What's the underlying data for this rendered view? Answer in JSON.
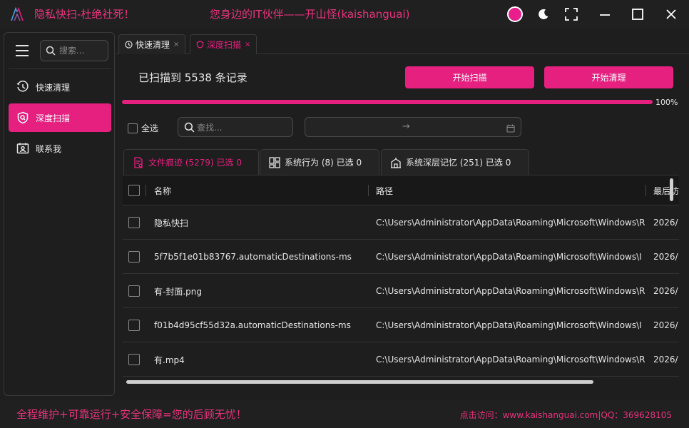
{
  "app": {
    "title": "隐私快扫-杜绝社死！",
    "slogan": "您身边的IT伙伴——开山怪(kaishanguai)"
  },
  "window_controls": {
    "theme_dot_color": "#e91e8c",
    "icons": [
      "theme-dot-icon",
      "moon-icon",
      "fullscreen-icon",
      "minimize-icon",
      "maximize-icon",
      "close-icon"
    ]
  },
  "sidebar": {
    "search_placeholder": "搜索...",
    "items": [
      {
        "label": "快速清理",
        "icon": "clock-icon",
        "active": false
      },
      {
        "label": "深度扫描",
        "icon": "shield-search-icon",
        "active": true
      },
      {
        "label": "联系我",
        "icon": "contact-card-icon",
        "active": false
      }
    ]
  },
  "doc_tabs": [
    {
      "label": "快速清理",
      "icon": "clock-icon",
      "close": "×",
      "active": false
    },
    {
      "label": "深度扫描",
      "icon": "shield-icon",
      "close": "×",
      "active": true
    }
  ],
  "scan": {
    "status": "已扫描到 5538 条记录",
    "start_scan_label": "开始扫描",
    "start_clean_label": "开始清理",
    "progress_percent": 100,
    "progress_text": "100%"
  },
  "filters": {
    "select_all_label": "全选",
    "search_placeholder": "查找...",
    "date_arrow": "→"
  },
  "category_tabs": [
    {
      "label": "文件痕迹 (5279) 已选 0",
      "icon": "file-trace-icon",
      "active": true
    },
    {
      "label": "系统行为 (8) 已选 0",
      "icon": "windows-grid-icon",
      "active": false
    },
    {
      "label": "系统深层记忆 (251) 已选 0",
      "icon": "building-icon",
      "active": false
    }
  ],
  "table": {
    "columns": [
      "名称",
      "路径",
      "最后访"
    ],
    "rows": [
      {
        "name": "隐私快扫",
        "path": "C:\\Users\\Administrator\\AppData\\Roaming\\Microsoft\\Windows\\R",
        "time": "2026/"
      },
      {
        "name": "5f7b5f1e01b83767.automaticDestinations-ms",
        "path": "C:\\Users\\Administrator\\AppData\\Roaming\\Microsoft\\Windows\\I",
        "time": "2026/"
      },
      {
        "name": "有-封面.png",
        "path": "C:\\Users\\Administrator\\AppData\\Roaming\\Microsoft\\Windows\\R",
        "time": "2026/"
      },
      {
        "name": "f01b4d95cf55d32a.automaticDestinations-ms",
        "path": "C:\\Users\\Administrator\\AppData\\Roaming\\Microsoft\\Windows\\I",
        "time": "2026/"
      },
      {
        "name": "有.mp4",
        "path": "C:\\Users\\Administrator\\AppData\\Roaming\\Microsoft\\Windows\\R",
        "time": "2026/"
      }
    ]
  },
  "footer": {
    "left": "全程维护+可靠运行+安全保障=您的后顾无忧！",
    "right": "点击访问：www.kaishanguai.com|QQ：369628105"
  },
  "colors": {
    "accent": "#e5207f",
    "background": "#1e1e1e",
    "text": "#e6e6e6"
  }
}
